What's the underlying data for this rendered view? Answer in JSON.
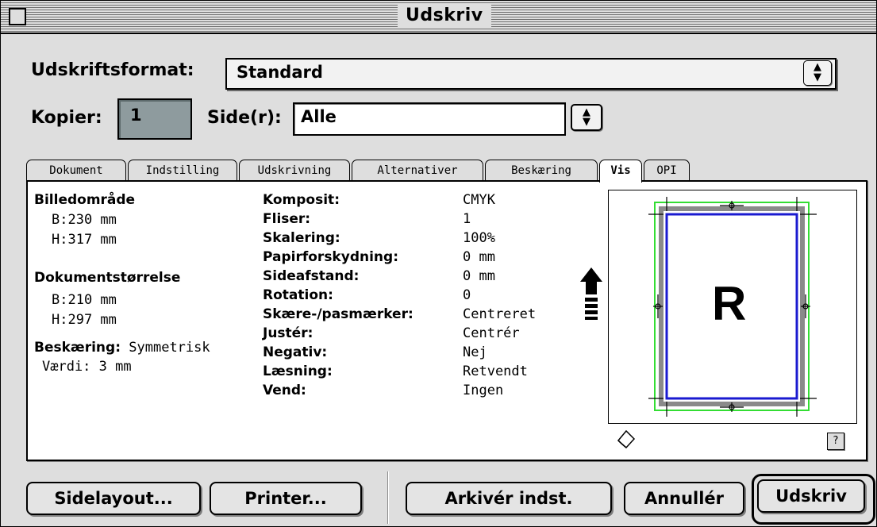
{
  "window": {
    "title": "Udskriv"
  },
  "print_format": {
    "label": "Udskriftsformat:",
    "value": "Standard"
  },
  "copies": {
    "label": "Kopier:",
    "value": "1"
  },
  "pages": {
    "label": "Side(r):",
    "value": "Alle"
  },
  "tabs": [
    {
      "label": "Dokument"
    },
    {
      "label": "Indstilling"
    },
    {
      "label": "Udskrivning"
    },
    {
      "label": "Alternativer"
    },
    {
      "label": "Beskæring"
    },
    {
      "label": "Vis",
      "active": true
    },
    {
      "label": "OPI"
    }
  ],
  "info": {
    "image_area": {
      "heading": "Billedområde",
      "width": "B:230 mm",
      "height": "H:317 mm"
    },
    "document_size": {
      "heading": "Dokumentstørrelse",
      "width": "B:210 mm",
      "height": "H:297 mm"
    },
    "bleed": {
      "label": "Beskæring:",
      "value": "Symmetrisk",
      "amount": "Værdi:  3 mm"
    }
  },
  "settings": [
    {
      "label": "Komposit:",
      "value": "CMYK"
    },
    {
      "label": "Fliser:",
      "value": "1"
    },
    {
      "label": "Skalering:",
      "value": "100%"
    },
    {
      "label": "Papirforskydning:",
      "value": "0 mm"
    },
    {
      "label": "Sideafstand:",
      "value": "0 mm"
    },
    {
      "label": "Rotation:",
      "value": "0"
    },
    {
      "label": "Skære-/pasmærker:",
      "value": "Centreret"
    },
    {
      "label": "Justér:",
      "value": "Centrér"
    },
    {
      "label": "Negativ:",
      "value": "Nej"
    },
    {
      "label": "Læsning:",
      "value": "Retvendt"
    },
    {
      "label": "Vend:",
      "value": "Ingen"
    }
  ],
  "preview": {
    "letter": "R",
    "help": "?",
    "trim_color": "#1a1ad0",
    "bleed_color": "#33dd33",
    "page_color": "#8a8a8a"
  },
  "buttons": {
    "page_layout": "Sidelayout...",
    "printer": "Printer...",
    "save_settings": "Arkivér indst.",
    "cancel": "Annullér",
    "print": "Udskriv"
  },
  "icons": {
    "feed_arrow": "up-arrow-icon",
    "paper": "paper-orientation-icon",
    "close": "close-box-icon"
  }
}
